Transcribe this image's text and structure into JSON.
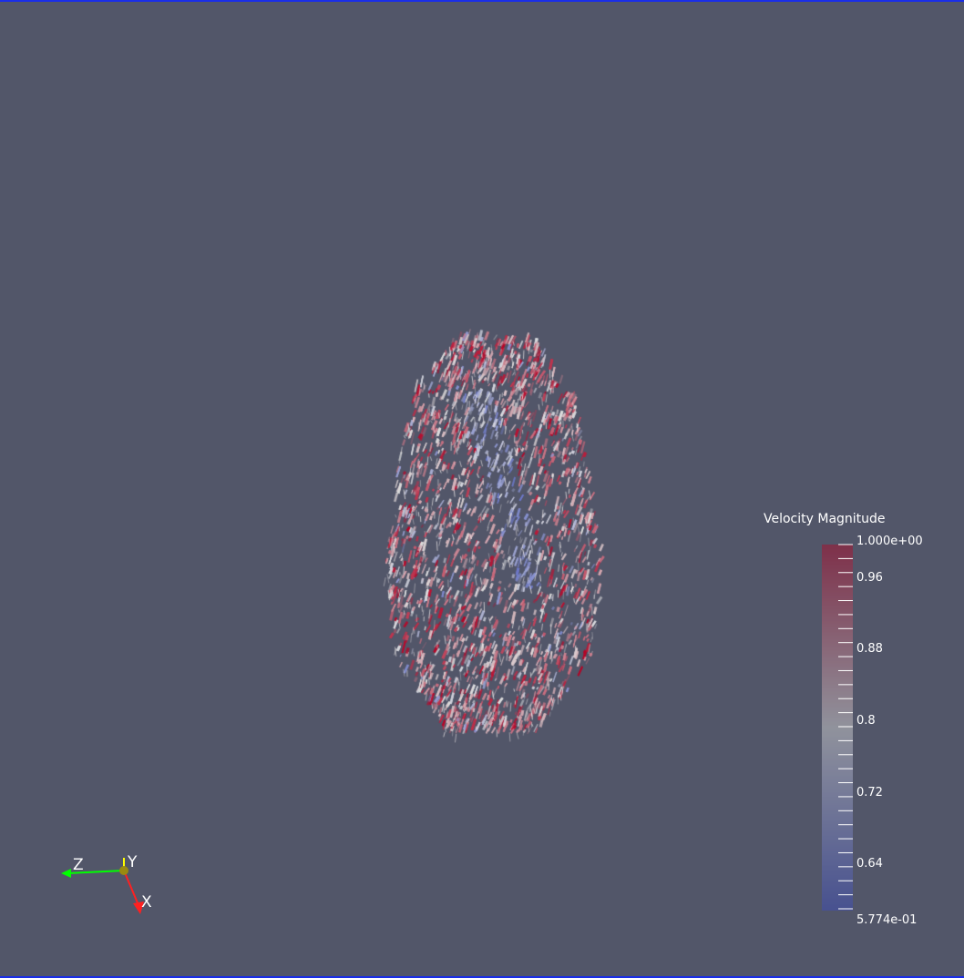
{
  "colorbar": {
    "title": "Velocity Magnitude",
    "max_label": "1.000e+00",
    "min_label": "5.774e-01",
    "tick_labels": [
      "0.96",
      "0.88",
      "0.8",
      "0.72",
      "0.64"
    ],
    "range": [
      0.5774,
      1.0
    ],
    "colormap": {
      "low": "#3b4cc0",
      "mid": "#dddddd",
      "high": "#b40426"
    }
  },
  "axes": {
    "z_label": "Z",
    "y_label": "Y",
    "x_label": "X",
    "x_color": "#ff0000",
    "y_color": "#ffff00",
    "z_color": "#00ff00"
  },
  "view": {
    "background": "#525669",
    "border_color": "#1a2ee8",
    "dataset_icon": "volume-render-plume"
  }
}
